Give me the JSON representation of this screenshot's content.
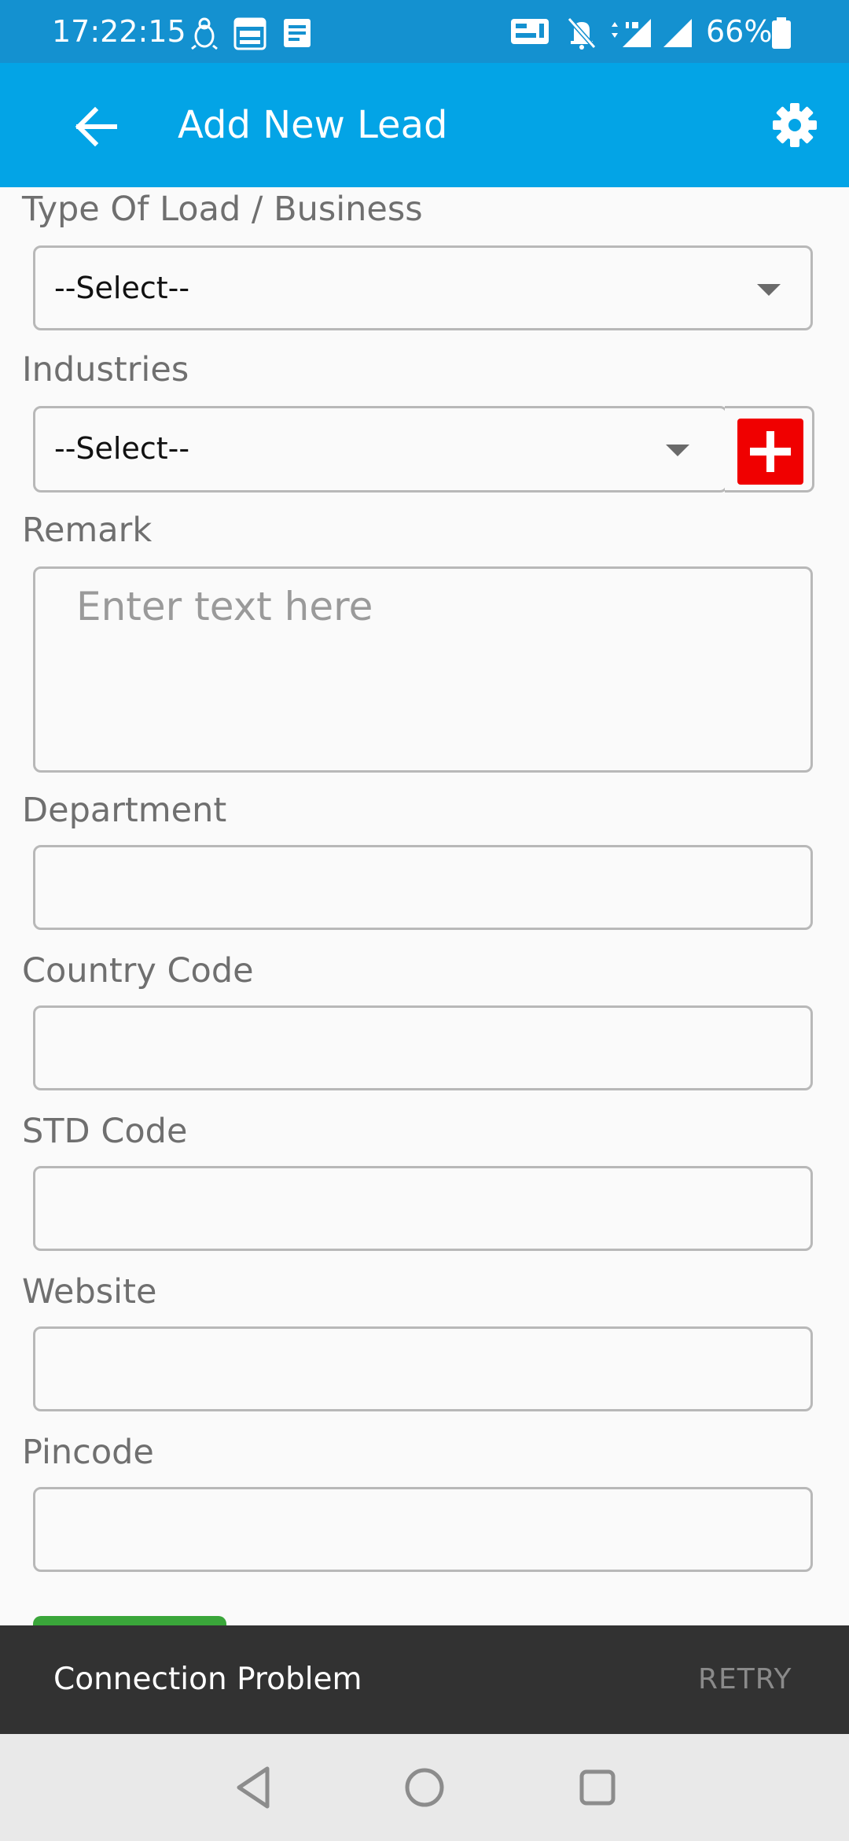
{
  "status_bar": {
    "time": "17:22:15",
    "battery": "66%",
    "icons": [
      "bird-icon",
      "calendar-2022-icon",
      "news-icon",
      "volte-icon",
      "mute-icon",
      "4g-signal-icon",
      "signal-icon",
      "battery-icon"
    ]
  },
  "app_bar": {
    "title": "Add New Lead",
    "back_icon": "arrow-back-icon",
    "settings_icon": "gear-icon",
    "background": "#03a4e6"
  },
  "form": {
    "type_label": "Type Of Load / Business",
    "type_value": "--Select--",
    "industries_label": "Industries",
    "industries_value": "--Select--",
    "add_industry_icon": "plus-icon",
    "remark_label": "Remark",
    "remark_placeholder": "Enter text here",
    "department_label": "Department",
    "department_value": "",
    "country_code_label": "Country Code",
    "country_code_value": "",
    "std_code_label": "STD Code",
    "std_code_value": "",
    "website_label": "Website",
    "website_value": "",
    "pincode_label": "Pincode",
    "pincode_value": ""
  },
  "snackbar": {
    "message": "Connection Problem",
    "action": "RETRY"
  },
  "colors": {
    "accent": "#03a4e6",
    "add_button": "#f00000",
    "submit_button": "#3aa63a",
    "snackbar": "#323232"
  }
}
